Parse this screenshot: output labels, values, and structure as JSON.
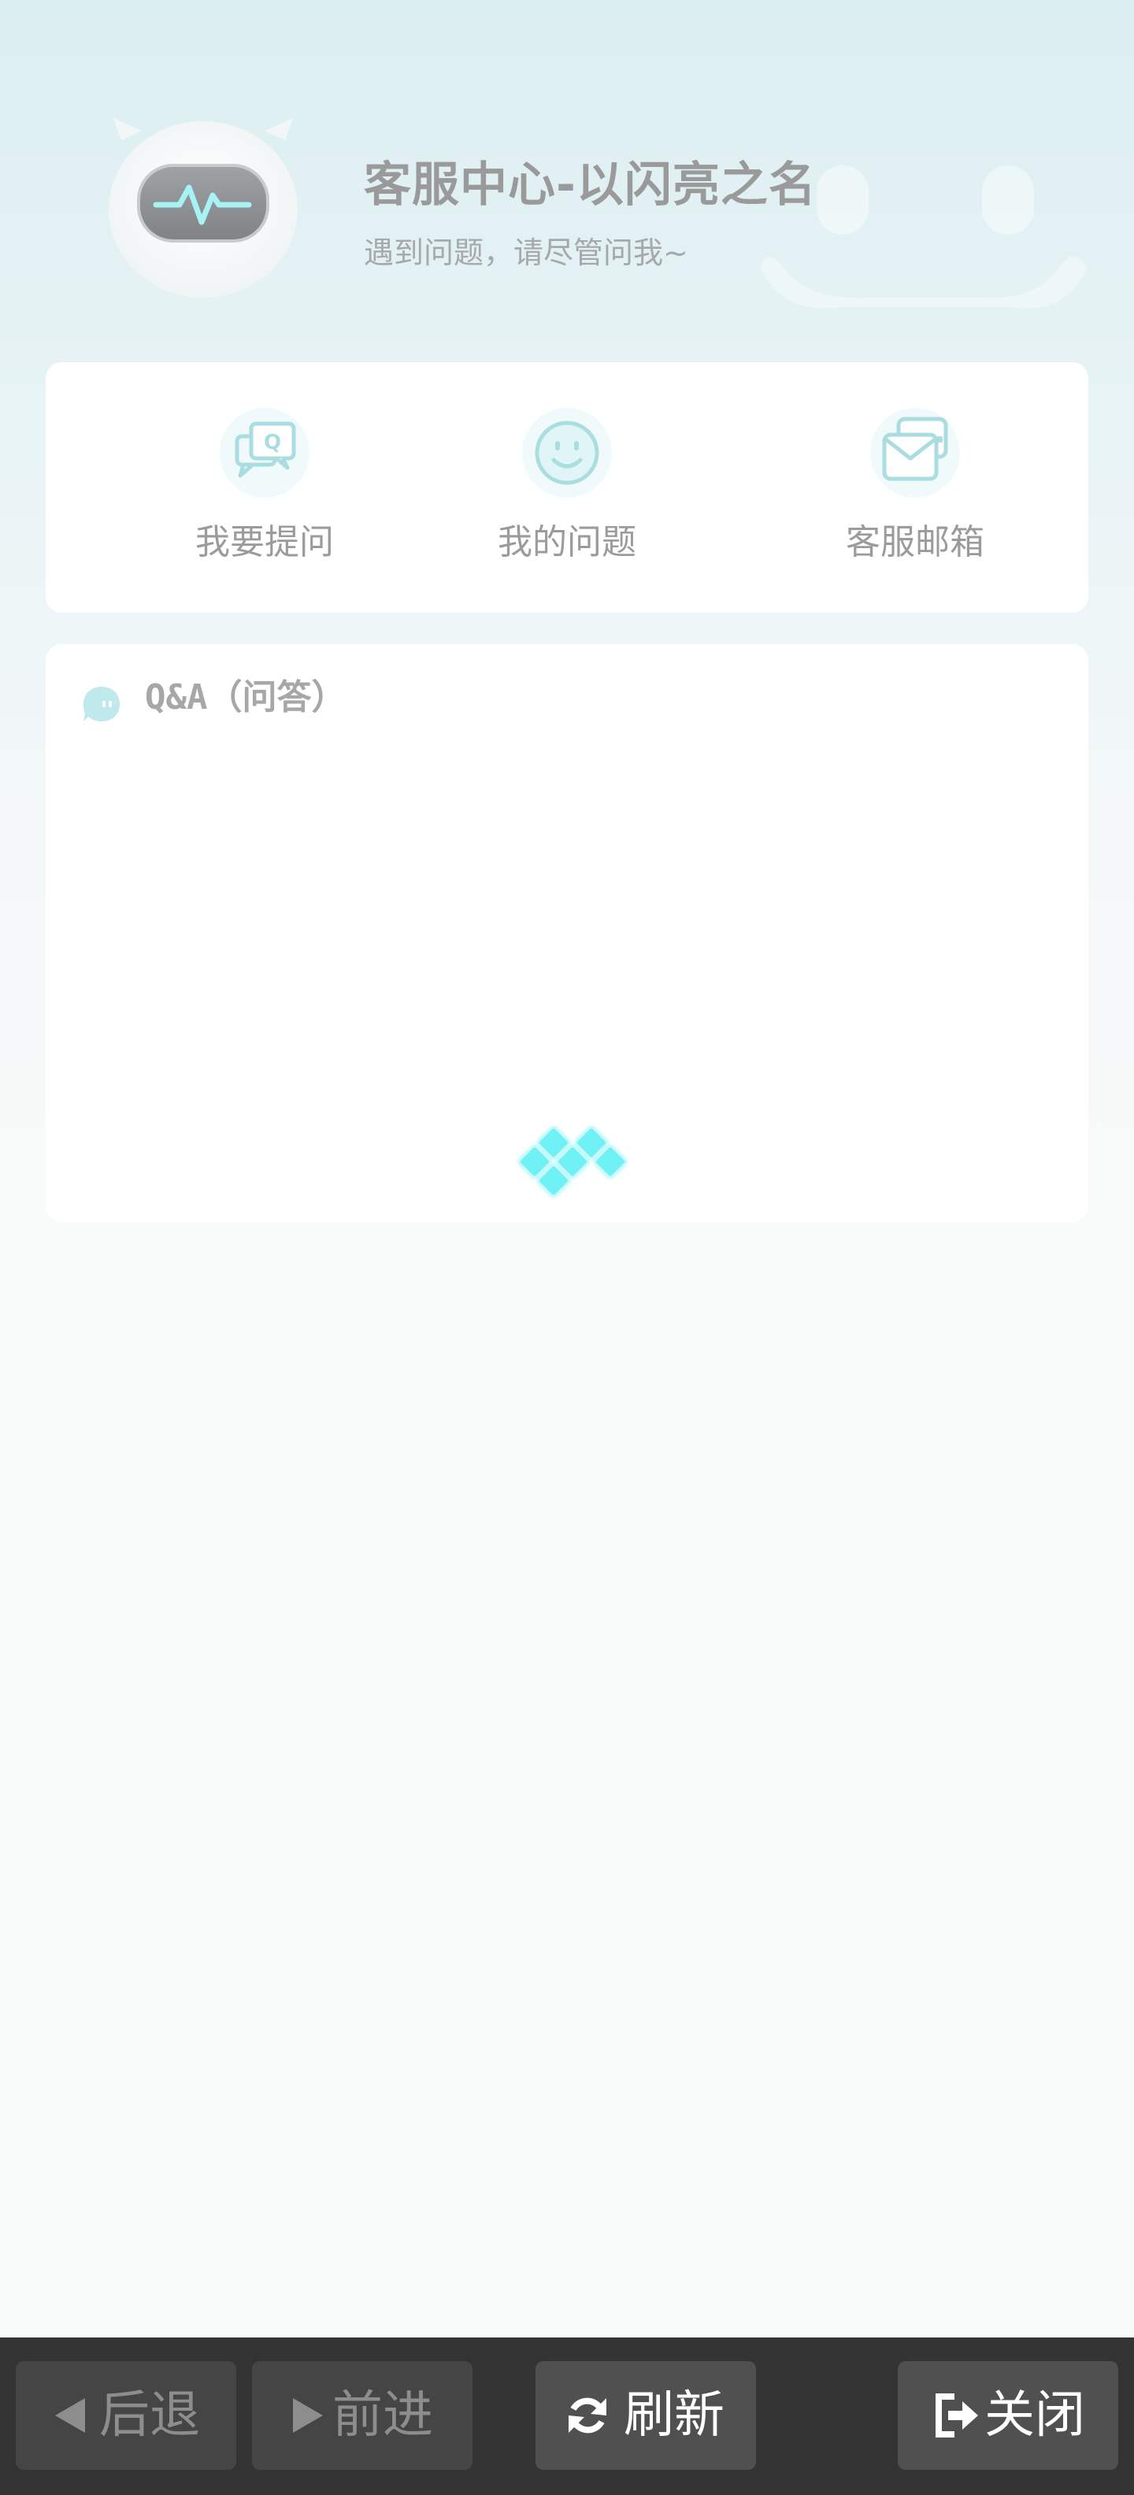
{
  "header": {
    "title": "客服中心-以闪亮之名",
    "subtitle": "遇到问题，请尽管问我~"
  },
  "actions": [
    {
      "label": "我要提问",
      "icon": "question-chat-icon"
    },
    {
      "label": "我的问题",
      "icon": "smiley-icon"
    },
    {
      "label": "客服邮箱",
      "icon": "mail-icon"
    }
  ],
  "qa": {
    "title": "Q&A（问答）",
    "state": "loading"
  },
  "nav": {
    "back_label": "后退",
    "forward_label": "前进",
    "refresh_label": "刷新",
    "close_label": "关闭"
  },
  "colors": {
    "accent": "#6ff1f5",
    "icon_teal": "#a9dde0",
    "bar_bg": "#333333"
  }
}
